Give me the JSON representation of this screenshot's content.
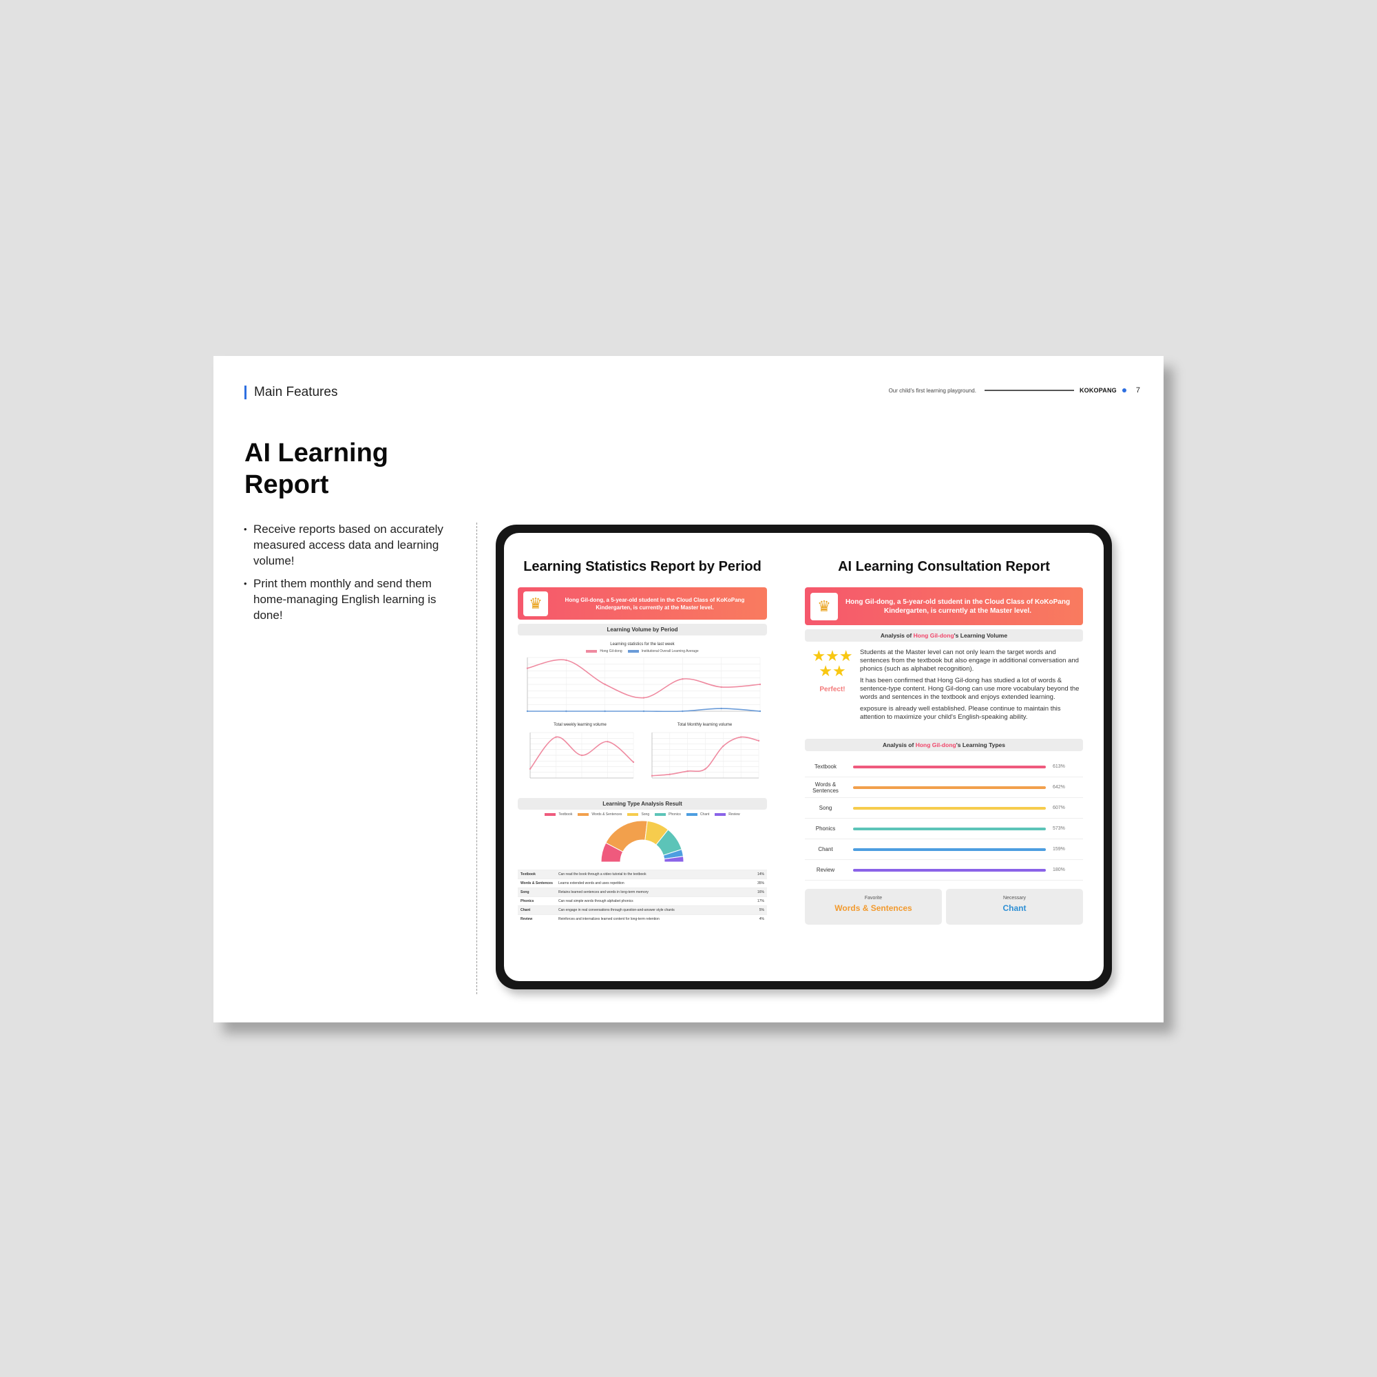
{
  "header": {
    "section_label": "Main Features",
    "tagline": "Our child's first learning playground.",
    "brand": "KOKOPANG",
    "page_number": "7"
  },
  "title_line1": "AI Learning",
  "title_line2": "Report",
  "bullets": [
    "Receive reports based on accurately measured access data and learning volume!",
    "Print them monthly and send them home-managing English learning is done!"
  ],
  "stats_report": {
    "title": "Learning Statistics Report by Period",
    "banner": "Hong Gil-dong, a 5-year-old student in the Cloud Class of KoKoPang Kindergarten, is currently at the Master level.",
    "volume_pill": "Learning Volume by Period",
    "chart1_title": "Learning statistics for the last week",
    "chart1_legend": [
      "Hong Gil-dong",
      "Institutional Overall Learning Average"
    ],
    "chart2_title": "Total weekly learning volume",
    "chart3_title": "Total Monthly learning volume",
    "type_pill": "Learning Type Analysis Result",
    "type_legend": [
      "Textbook",
      "Words & Sentences",
      "Song",
      "Phonics",
      "Chant",
      "Review"
    ],
    "type_rows": [
      {
        "name": "Textbook",
        "desc": "Can read the book through a video tutorial to the textbook",
        "pct": "14%"
      },
      {
        "name": "Words & Sentences",
        "desc": "Learns extended words and uses repetition",
        "pct": "35%"
      },
      {
        "name": "Song",
        "desc": "Retains learned sentences and words in long-term memory",
        "pct": "16%"
      },
      {
        "name": "Phonics",
        "desc": "Can read simple words through alphabet phonics",
        "pct": "17%"
      },
      {
        "name": "Chant",
        "desc": "Can engage in real conversations through question-and-answer style chants",
        "pct": "5%"
      },
      {
        "name": "Review",
        "desc": "Reinforces and internalizes learned content for long-term retention",
        "pct": "4%"
      }
    ]
  },
  "consult_report": {
    "title": "AI Learning Consultation Report",
    "banner": "Hong Gil-dong, a 5-year-old student in the Cloud Class of KoKoPang Kindergarten, is currently at the Master level.",
    "volume_pill": {
      "pre": "Analysis of ",
      "name": "Hong Gil-dong",
      "post": "'s Learning Volume"
    },
    "perfect": "Perfect!",
    "paragraphs": [
      "Students at the Master level can not only learn the target words and sentences from the textbook but also engage in additional conversation and phonics (such as alphabet recognition).",
      "It has been confirmed that Hong Gil-dong has studied a lot of words & sentence-type content. Hong Gil-dong can use more vocabulary beyond the words and sentences in the textbook and enjoys extended learning.",
      "exposure is already well established. Please continue to maintain this attention to maximize your child's English-speaking ability."
    ],
    "types_pill": {
      "pre": "Analysis of ",
      "name": "Hong Gil-dong",
      "post": "'s Learning Types"
    },
    "type_bars": [
      {
        "label": "Textbook",
        "pct": "613%",
        "color": "#ef5a7d",
        "fill": 1.0
      },
      {
        "label": "Words & Sentences",
        "pct": "642%",
        "color": "#f2a04c",
        "fill": 1.0
      },
      {
        "label": "Song",
        "pct": "607%",
        "color": "#f6cc4d",
        "fill": 1.0
      },
      {
        "label": "Phonics",
        "pct": "573%",
        "color": "#5cc4b8",
        "fill": 1.0
      },
      {
        "label": "Chant",
        "pct": "159%",
        "color": "#4d9ee0",
        "fill": 1.0
      },
      {
        "label": "Review",
        "pct": "180%",
        "color": "#8a63e8",
        "fill": 1.0
      }
    ],
    "favorite_label": "Favorite",
    "favorite_value": "Words & Sentences",
    "favorite_color": "#f29a2e",
    "necessary_label": "Necessary",
    "necessary_value": "Chant",
    "necessary_color": "#2d8fd4"
  },
  "chart_data": [
    {
      "type": "line",
      "title": "Learning statistics for the last week",
      "series": [
        {
          "name": "Hong Gil-dong",
          "values": [
            16,
            19,
            10,
            5,
            12,
            9,
            10
          ]
        },
        {
          "name": "Institutional Overall Learning Average",
          "values": [
            0,
            0,
            0,
            0,
            0,
            1,
            0
          ]
        }
      ],
      "colors": [
        "#ef8aa0",
        "#6a9bd8"
      ]
    },
    {
      "type": "line",
      "title": "Total weekly learning volume",
      "series": [
        {
          "name": "",
          "values": [
            20,
            90,
            50,
            80,
            35
          ]
        }
      ],
      "colors": [
        "#ef8aa0"
      ]
    },
    {
      "type": "line",
      "title": "Total Monthly learning volume",
      "series": [
        {
          "name": "",
          "values": [
            5,
            8,
            15,
            20,
            70,
            90,
            82
          ]
        }
      ],
      "colors": [
        "#ef8aa0"
      ]
    },
    {
      "type": "pie",
      "title": "Learning Type Analysis Result",
      "categories": [
        "Textbook",
        "Words & Sentences",
        "Song",
        "Phonics",
        "Chant",
        "Review"
      ],
      "values": [
        14,
        35,
        16,
        17,
        5,
        4
      ],
      "colors": [
        "#ef5a7d",
        "#f2a04c",
        "#f6cc4d",
        "#5cc4b8",
        "#4d9ee0",
        "#8a63e8"
      ]
    }
  ]
}
